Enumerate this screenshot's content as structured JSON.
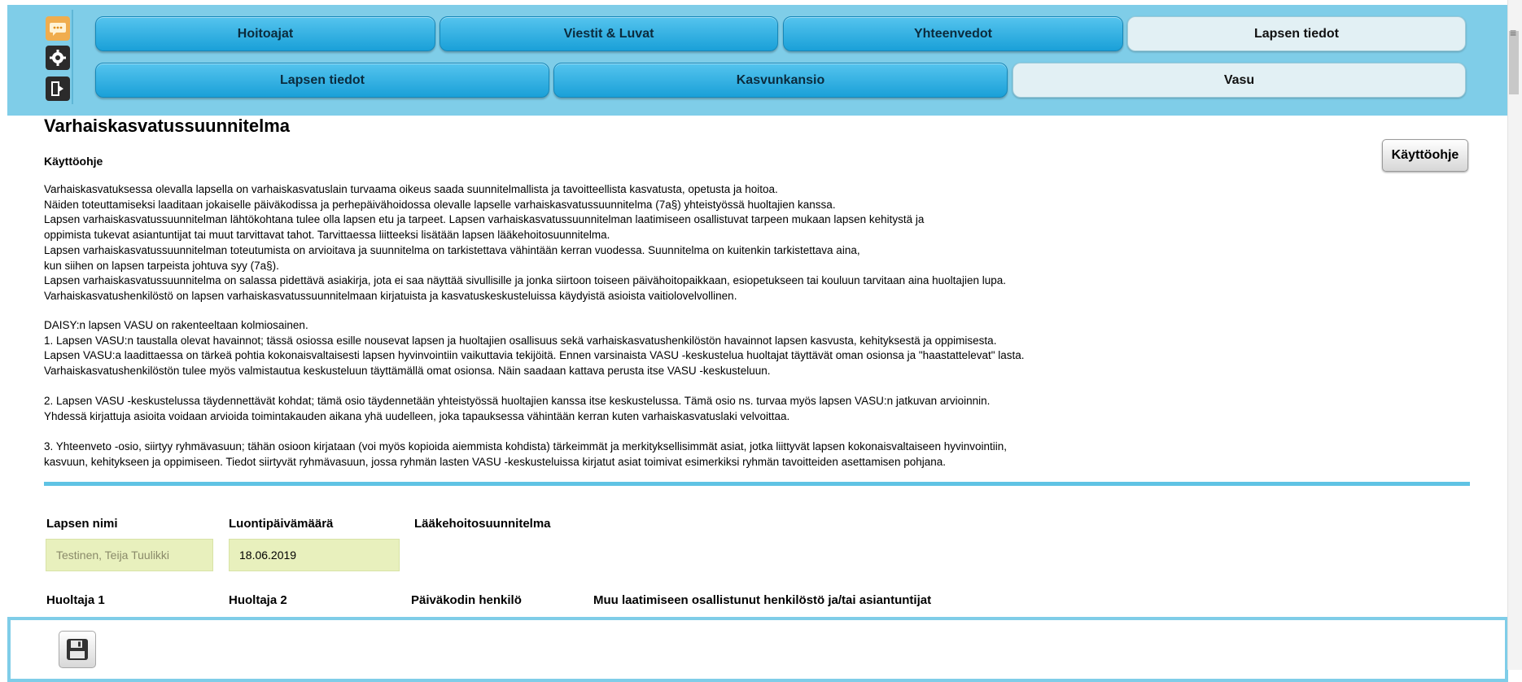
{
  "nav": {
    "top_tabs": [
      {
        "label": "Hoitoajat",
        "active": false
      },
      {
        "label": "Viestit & Luvat",
        "active": false
      },
      {
        "label": "Yhteenvedot",
        "active": false
      },
      {
        "label": "Lapsen tiedot",
        "active": true
      }
    ],
    "sub_tabs": [
      {
        "label": "Lapsen tiedot",
        "active": false
      },
      {
        "label": "Kasvunkansio",
        "active": false
      },
      {
        "label": "Vasu",
        "active": true
      }
    ],
    "side_icons": [
      "chat-icon",
      "gear-icon",
      "exit-icon"
    ]
  },
  "page": {
    "title": "Varhaiskasvatussuunnitelma",
    "instructions_heading": "Käyttöohje",
    "help_button": "Käyttöohje",
    "paragraphs": [
      [
        "Varhaiskasvatuksessa olevalla lapsella on varhaiskasvatuslain turvaama oikeus saada suunnitelmallista ja tavoitteellista kasvatusta, opetusta ja hoitoa.",
        "Näiden toteuttamiseksi laaditaan jokaiselle päiväkodissa ja perhepäivähoidossa olevalle lapselle varhaiskasvatussuunnitelma (7a§) yhteistyössä huoltajien kanssa.",
        "Lapsen varhaiskasvatussuunnitelman lähtökohtana tulee olla lapsen etu ja tarpeet. Lapsen varhaiskasvatussuunnitelman laatimiseen osallistuvat tarpeen mukaan lapsen kehitystä ja",
        "oppimista tukevat asiantuntijat tai muut tarvittavat tahot. Tarvittaessa liitteeksi lisätään lapsen lääkehoitosuunnitelma.",
        "Lapsen varhaiskasvatussuunnitelman toteutumista on arvioitava ja suunnitelma on tarkistettava vähintään kerran vuodessa. Suunnitelma on kuitenkin tarkistettava aina,",
        "kun siihen on lapsen tarpeista johtuva syy (7a§).",
        "Lapsen varhaiskasvatussuunnitelma on salassa pidettävä asiakirja, jota ei saa näyttää sivullisille ja jonka siirtoon toiseen päivähoitopaikkaan, esiopetukseen tai kouluun tarvitaan aina huoltajien lupa.",
        "Varhaiskasvatushenkilöstö on lapsen varhaiskasvatussuunnitelmaan kirjatuista ja kasvatuskeskusteluissa käydyistä asioista vaitiolovelvollinen."
      ],
      [
        "DAISY:n lapsen VASU on rakenteeltaan kolmiosainen.",
        "1. Lapsen VASU:n taustalla olevat havainnot; tässä osiossa esille nousevat lapsen ja huoltajien osallisuus sekä varhaiskasvatushenkilöstön havainnot lapsen kasvusta, kehityksestä ja oppimisesta.",
        "Lapsen VASU:a laadittaessa on tärkeä pohtia kokonaisvaltaisesti lapsen hyvinvointiin vaikuttavia tekijöitä. Ennen varsinaista VASU -keskustelua huoltajat täyttävät oman osionsa ja \"haastattelevat\" lasta.",
        "Varhaiskasvatushenkilöstön tulee myös valmistautua keskusteluun täyttämällä omat osionsa. Näin saadaan kattava perusta itse VASU -keskusteluun."
      ],
      [
        "2. Lapsen VASU -keskustelussa täydennettävät kohdat; tämä osio täydennetään yhteistyössä huoltajien kanssa itse keskustelussa. Tämä osio ns. turvaa myös lapsen VASU:n jatkuvan arvioinnin.",
        "Yhdessä kirjattuja asioita voidaan arvioida toimintakauden aikana yhä uudelleen, joka tapauksessa vähintään kerran kuten varhaiskasvatuslaki velvoittaa."
      ],
      [
        "3. Yhteenveto -osio, siirtyy ryhmävasuun; tähän osioon kirjataan (voi myös kopioida aiemmista kohdista) tärkeimmät ja merkityksellisimmät asiat, jotka liittyvät lapsen kokonaisvaltaiseen hyvinvointiin,",
        "kasvuun, kehitykseen ja oppimiseen. Tiedot siirtyvät ryhmävasuun, jossa ryhmän lasten VASU -keskusteluissa kirjatut asiat toimivat esimerkiksi ryhmän tavoitteiden asettamisen pohjana."
      ]
    ]
  },
  "form": {
    "child_name_label": "Lapsen nimi",
    "child_name_value": "Testinen, Teija Tuulikki",
    "created_label": "Luontipäivämäärä",
    "created_value": "18.06.2019",
    "medication_label": "Lääkehoitosuunnitelma",
    "guardian1_label": "Huoltaja 1",
    "guardian2_label": "Huoltaja 2",
    "daycare_person_label": "Päiväkodin henkilö",
    "other_staff_label": "Muu laatimiseen osallistunut henkilöstö ja/tai asiantuntijat"
  },
  "toolbar": {
    "save_icon": "floppy-disk-icon"
  },
  "colors": {
    "header_bg": "#7fcde8",
    "tab_blue": "#2aa9df",
    "tab_active": "#e2f0f4",
    "field_bg": "#e8f0bd",
    "divider": "#5fc3e4",
    "chat_icon": "#f0ad4e"
  }
}
